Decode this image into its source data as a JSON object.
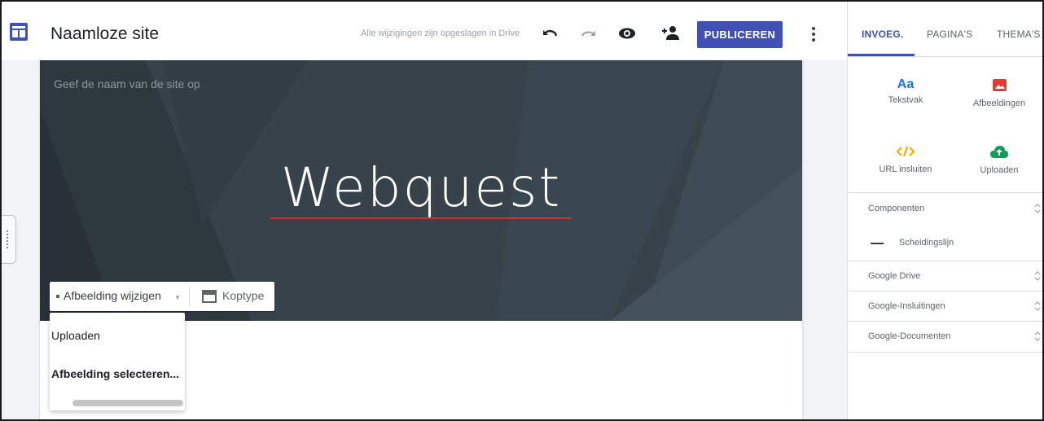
{
  "topbar": {
    "site_title": "Naamloze site",
    "saved_status": "Alle wijzigingen zijn opgeslagen in Drive",
    "publish_label": "PUBLICEREN"
  },
  "header": {
    "site_name_placeholder": "Geef de naam van de site op",
    "title": "Webquest",
    "toolbar": {
      "change_image_label": "Afbeelding wijzigen",
      "header_type_label": "Koptype"
    }
  },
  "image_menu": {
    "items": [
      "Uploaden",
      "Afbeelding selecteren..."
    ]
  },
  "panel": {
    "tabs": [
      "INVOEG.",
      "PAGINA'S",
      "THEMA'S"
    ],
    "insert_items": {
      "textbox": {
        "glyph": "Aa",
        "label": "Tekstvak"
      },
      "images": {
        "label": "Afbeeldingen"
      },
      "embed": {
        "label": "URL insluiten"
      },
      "upload": {
        "label": "Uploaden"
      }
    },
    "sections": [
      {
        "label": "Componenten"
      },
      {
        "label": "Google Drive"
      },
      {
        "label": "Google-Insluitingen"
      },
      {
        "label": "Google-Documenten"
      }
    ],
    "components": [
      {
        "label": "Scheidingslijn"
      }
    ]
  },
  "colors": {
    "accent": "#3f51b5",
    "header_bg": "#37424b",
    "image_icon": "#e53935",
    "embed_icon": "#f9ab00",
    "upload_icon": "#0f9d58"
  }
}
